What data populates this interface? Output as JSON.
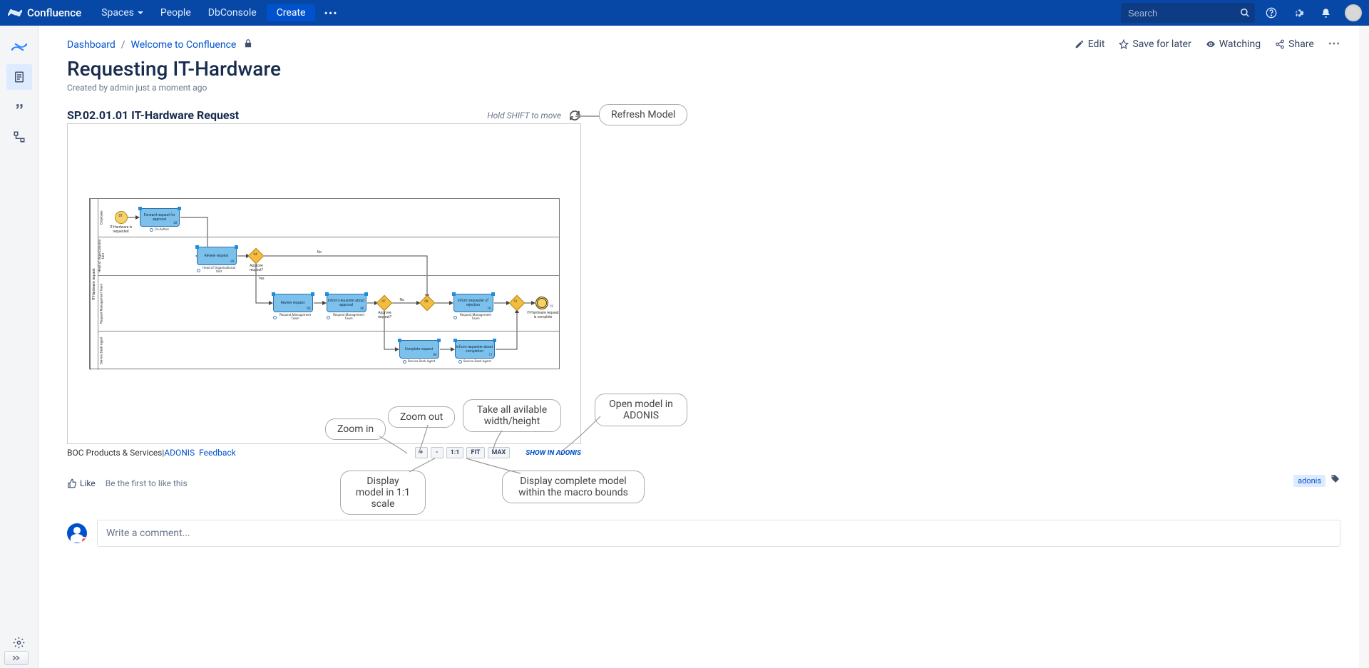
{
  "header": {
    "product": "Confluence",
    "nav": {
      "spaces": "Spaces",
      "people": "People",
      "dbconsole": "DbConsole",
      "create": "Create",
      "more": "•••"
    },
    "search_placeholder": "Search"
  },
  "breadcrumb": {
    "dashboard": "Dashboard",
    "welcome": "Welcome to Confluence"
  },
  "page_actions": {
    "edit": "Edit",
    "save": "Save for later",
    "watching": "Watching",
    "share": "Share"
  },
  "page": {
    "title": "Requesting IT-Hardware",
    "byline": "Created by admin just a moment ago"
  },
  "macro": {
    "title": "SP.02.01.01 IT-Hardware Request",
    "hint": "Hold SHIFT to move",
    "pool": "IT-Hardware request",
    "lanes": {
      "l1": "Employee",
      "l2": "Head of Organizational Unit",
      "l3": "Request Management Team",
      "l4": "Service Desk Agent"
    },
    "start_label": "IT-Hardware is requested",
    "end_label": "IT-Hardware request is complete",
    "tasks": {
      "t1": "Forward request for approval",
      "t1a": "Co-Author",
      "t2": "Review request",
      "t2a": "Head of Organisational Unit",
      "t3": "Review request",
      "t3a": "Request Management Team",
      "t4": "Inform requester about approval",
      "t4a": "Request Management Team",
      "t5": "Inform requester of rejection",
      "t5a": "Request Management Team",
      "t6": "Complete request",
      "t6a": "Service Desk Agent",
      "t7": "Inform requester about completion",
      "t7a": "Service Desk Agent"
    },
    "gateways": {
      "g1": "Approve request?",
      "g2": "Approve request?",
      "g3": ""
    },
    "seq": {
      "no1": "No",
      "yes1": "Yes",
      "no2": "No"
    },
    "nums": {
      "n1": "01",
      "n2": "02",
      "n3": "03",
      "n4": "04",
      "n5": "05",
      "n6": "06",
      "n7": "07",
      "n8": "08",
      "n9": "09",
      "n10": "10",
      "n11": "11",
      "n12": "12",
      "n13": "13"
    }
  },
  "footer": {
    "boc": "BOC Products & Services",
    "pipe": " | ",
    "adonis": "ADONIS",
    "feedback": "Feedback",
    "plus": "+",
    "minus": "-",
    "one": "1:1",
    "fit": "FIT",
    "max": "MAX",
    "show": "SHOW IN ADONIS"
  },
  "callouts": {
    "refresh": "Refresh Model",
    "zoom_in": "Zoom in",
    "zoom_out": "Zoom out",
    "take_wh": "Take all avilable width/height",
    "open_adonis": "Open model in ADONIS",
    "scale11": "Display model in 1:1 scale",
    "complete": "Display complete model within the macro bounds"
  },
  "like": {
    "like": "Like",
    "first": "Be the first to like this"
  },
  "tag": "adonis",
  "comment_placeholder": "Write a comment..."
}
